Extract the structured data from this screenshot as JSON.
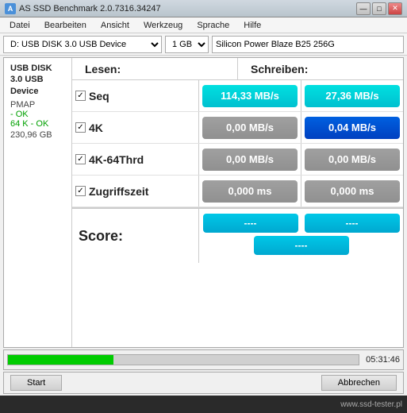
{
  "titlebar": {
    "title": "AS SSD Benchmark 2.0.7316.34247",
    "icon": "A",
    "buttons": {
      "minimize": "—",
      "maximize": "□",
      "close": "✕"
    }
  },
  "menubar": {
    "items": [
      "Datei",
      "Bearbeiten",
      "Ansicht",
      "Werkzeug",
      "Sprache",
      "Hilfe"
    ]
  },
  "toolbar": {
    "drive": "D: USB DISK 3.0 USB Device",
    "size": "1 GB",
    "device_name": "Silicon Power Blaze B25 256G"
  },
  "left_panel": {
    "device_line1": "USB DISK 3.0 USB",
    "device_line2": "Device",
    "pmap": "PMAP",
    "ok1": "- OK",
    "ok2": "64 K - OK",
    "disk_size": "230,96 GB"
  },
  "headers": {
    "read": "Lesen:",
    "write": "Schreiben:"
  },
  "rows": [
    {
      "label": "Seq",
      "read_value": "114,33 MB/s",
      "read_style": "cyan",
      "write_value": "27,36 MB/s",
      "write_style": "cyan"
    },
    {
      "label": "4K",
      "read_value": "0,00 MB/s",
      "read_style": "gray",
      "write_value": "0,04 MB/s",
      "write_style": "blue"
    },
    {
      "label": "4K-64Thrd",
      "read_value": "0,00 MB/s",
      "read_style": "gray",
      "write_value": "0,00 MB/s",
      "write_style": "gray"
    },
    {
      "label": "Zugriffszeit",
      "read_value": "0,000 ms",
      "read_style": "gray",
      "write_value": "0,000 ms",
      "write_style": "gray"
    }
  ],
  "score": {
    "label": "Score:",
    "read_score": "----",
    "write_score": "----",
    "total_score": "----"
  },
  "progress": {
    "fill_percent": 30,
    "time": "05:31:46"
  },
  "buttons": {
    "start": "Start",
    "abort": "Abbrechen"
  },
  "watermark": {
    "text": "www.ssd-tester.pl"
  }
}
